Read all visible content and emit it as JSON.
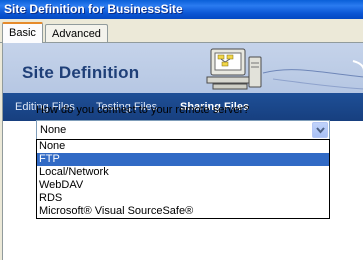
{
  "window": {
    "title": "Site Definition for BusinessSite"
  },
  "tabs": [
    {
      "label": "Basic",
      "active": true
    },
    {
      "label": "Advanced",
      "active": false
    }
  ],
  "banner": {
    "title": "Site Definition",
    "illustration": "computer-network-icon"
  },
  "nav": [
    {
      "label": "Editing Files",
      "active": false
    },
    {
      "label": "Testing Files",
      "active": false
    },
    {
      "label": "Sharing Files",
      "active": true
    }
  ],
  "form": {
    "question": "How do you connect to your remote server?",
    "selected_value": "None",
    "options": [
      "None",
      "FTP",
      "Local/Network",
      "WebDAV",
      "RDS",
      "Microsoft® Visual SourceSafe®"
    ],
    "highlighted_option": "FTP"
  },
  "colors": {
    "titlebar": "#0a5fd8",
    "banner": "#c5d3ea",
    "nav": "#1e4f96",
    "selection": "#316ac5",
    "tab_accent": "#e68b2c"
  }
}
